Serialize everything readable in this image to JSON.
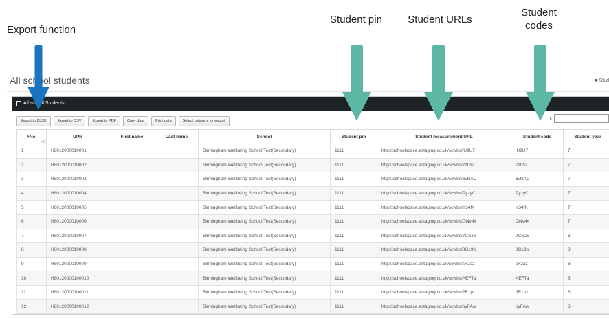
{
  "annotations": {
    "export": "Export function",
    "pin": "Student pin",
    "urls": "Student URLs",
    "codes_line1": "Student",
    "codes_line2": "codes"
  },
  "colors": {
    "export_arrow": "#1a74bf",
    "field_arrows": "#5cb8a5",
    "panel_header": "#1e2326"
  },
  "page": {
    "title": "All school students",
    "breadcrumb": "Stud"
  },
  "panel": {
    "title": "All school Students"
  },
  "toolbar": {
    "buttons": [
      "Export to XLSX",
      "Export to CSV",
      "Export to PDF",
      "Copy data",
      "Print data",
      "Select columns for export"
    ]
  },
  "search": {
    "label": "h:"
  },
  "table": {
    "headers": [
      "#No.",
      "UPN",
      "First name",
      "Last name",
      "School",
      "Student pin",
      "Student measurement URL",
      "Student code",
      "Student year"
    ],
    "rows": [
      [
        "1",
        "H8012000010001",
        "",
        "",
        "Birmingham Wellbeing School Test(Secondary)",
        "1111",
        "http://schoolspace.estaging.co.uk/scwbs/jU9U7",
        "jU9U7",
        "7"
      ],
      [
        "2",
        "H8012000010002",
        "",
        "",
        "Birmingham Wellbeing School Test(Secondary)",
        "1111",
        "http://schoolspace.estaging.co.uk/scwbs/7zf2u",
        "7zf2u",
        "7"
      ],
      [
        "3",
        "H8012000010003",
        "",
        "",
        "Birmingham Wellbeing School Test(Secondary)",
        "1111",
        "http://schoolspace.estaging.co.uk/scwbs/6vRAC",
        "6vRAC",
        "7"
      ],
      [
        "4",
        "H8012000010004",
        "",
        "",
        "Birmingham Wellbeing School Test(Secondary)",
        "1111",
        "http://schoolspace.estaging.co.uk/scwbs/PyzyC",
        "PyzyC",
        "7"
      ],
      [
        "5",
        "H8012000010005",
        "",
        "",
        "Birmingham Wellbeing School Test(Secondary)",
        "1111",
        "http://schoolspace.estaging.co.uk/scwbs/Y34fK",
        "Y34fK",
        "7"
      ],
      [
        "6",
        "H8012000010006",
        "",
        "",
        "Birmingham Wellbeing School Test(Secondary)",
        "1111",
        "http://schoolspace.estaging.co.uk/scwbs/GNv44",
        "GNv44",
        "7"
      ],
      [
        "7",
        "H8012000010007",
        "",
        "",
        "Birmingham Wellbeing School Test(Secondary)",
        "1111",
        "http://schoolspace.estaging.co.uk/scwbs/7CSJS",
        "7CSJS",
        "8"
      ],
      [
        "8",
        "H8012000010008",
        "",
        "",
        "Birmingham Wellbeing School Test(Secondary)",
        "1111",
        "http://schoolspace.estaging.co.uk/scwbs/8Gc9b",
        "8Gc9b",
        "8"
      ],
      [
        "9",
        "H8012000010009",
        "",
        "",
        "Birmingham Wellbeing School Test(Secondary)",
        "1111",
        "http://schoolspace.estaging.co.uk/scwbs/sF2az",
        "sF2az",
        "8"
      ],
      [
        "10",
        "H80120000100010",
        "",
        "",
        "Birmingham Wellbeing School Test(Secondary)",
        "1111",
        "http://schoolspace.estaging.co.uk/scwbs/AEFTa",
        "AEFTa",
        "8"
      ],
      [
        "11",
        "H80120000100011",
        "",
        "",
        "Birmingham Wellbeing School Test(Secondary)",
        "1111",
        "http://schoolspace.estaging.co.uk/scwbs/2E1p1",
        "2E1p1",
        "8"
      ],
      [
        "12",
        "H80120000100012",
        "",
        "",
        "Birmingham Wellbeing School Test(Secondary)",
        "1111",
        "http://schoolspace.estaging.co.uk/scwbs/byFAw",
        "byFAw",
        "8"
      ]
    ]
  }
}
